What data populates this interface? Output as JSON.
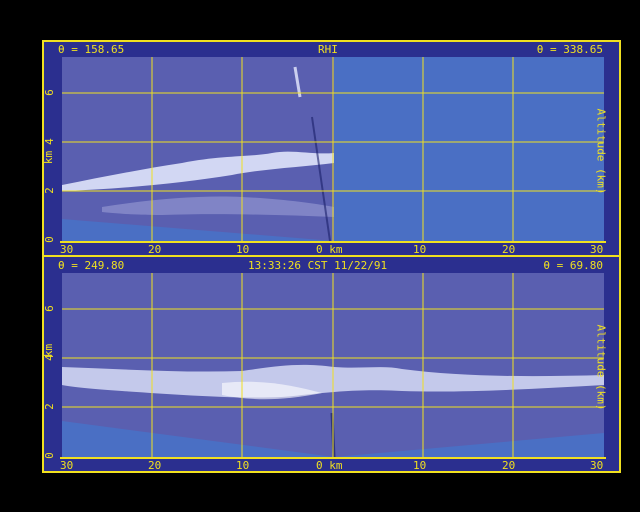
{
  "top_panel": {
    "left_label": "θ = 158.65",
    "center_label": "RHI",
    "right_label": "θ = 338.65",
    "y_axis_label": "km",
    "right_axis_label": "Altitude (km)",
    "y_ticks": [
      "0",
      "2",
      "4",
      "6"
    ],
    "x_ticks": [
      "30",
      "20",
      "10",
      "0 km",
      "10",
      "20",
      "30"
    ]
  },
  "bottom_panel": {
    "left_label": "θ = 249.80",
    "center_label": "13:33:26 CST 11/22/91",
    "right_label": "θ = 69.80",
    "y_axis_label": "km",
    "right_axis_label": "Altitude (km)",
    "y_ticks": [
      "0",
      "2",
      "4",
      "6"
    ],
    "x_ticks": [
      "30",
      "20",
      "10",
      "0 km",
      "10",
      "20",
      "30"
    ]
  },
  "colors": {
    "frame_bg": "#2b2f8f",
    "grid": "#f0e020",
    "data_bg": "#5a5fb0",
    "surface": "#4a6fc4",
    "cloud": "#e8ecff"
  }
}
